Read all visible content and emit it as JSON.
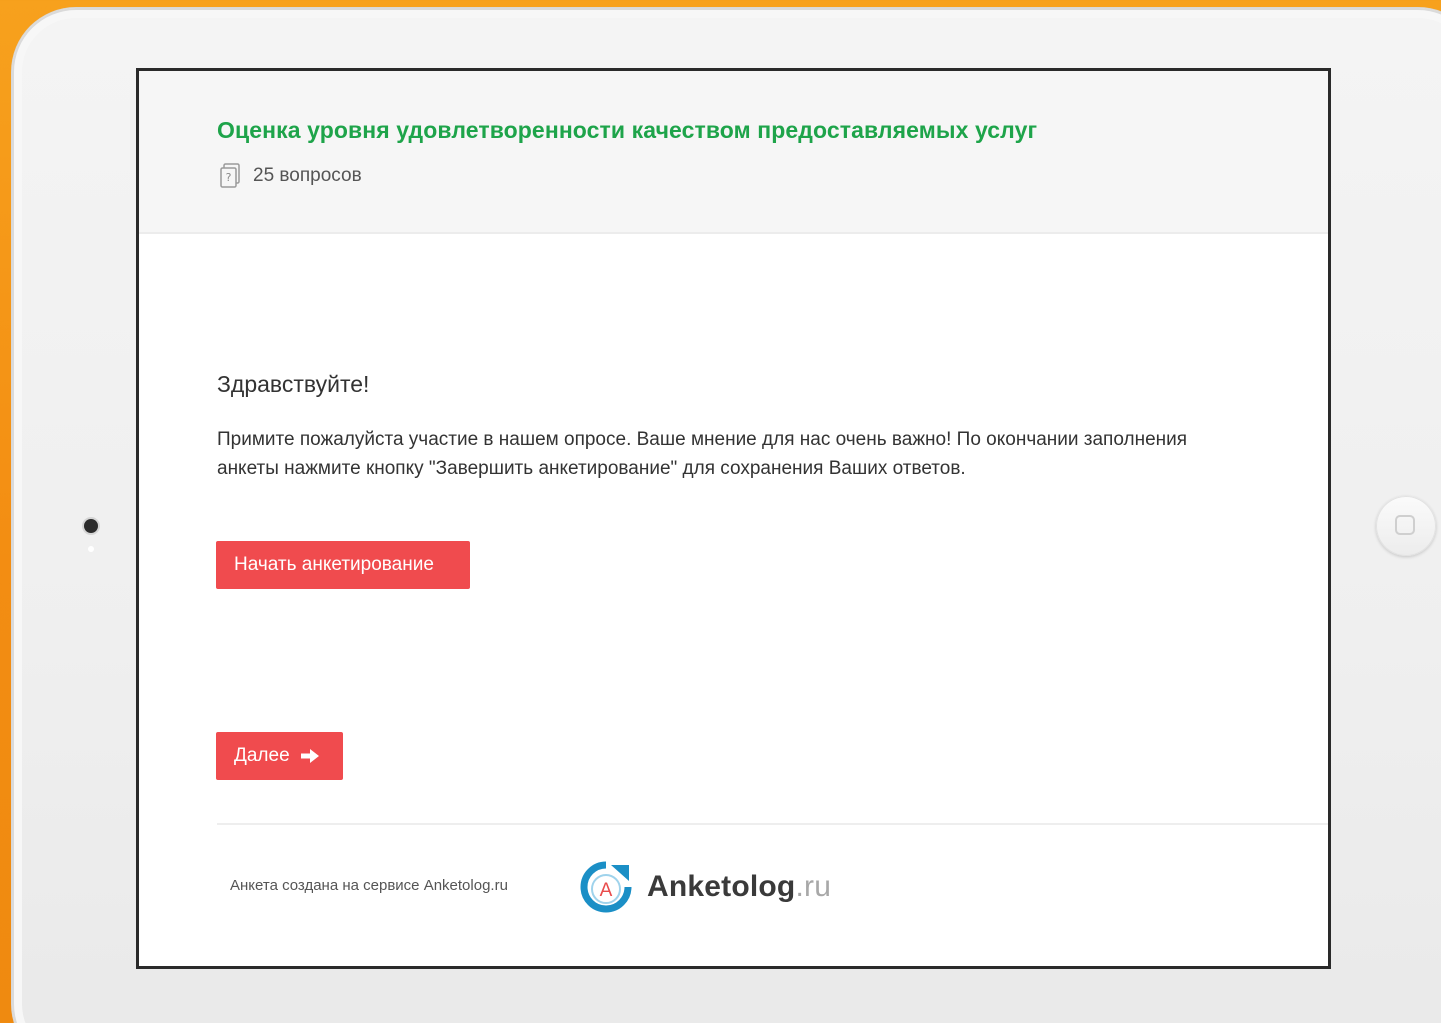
{
  "survey": {
    "title": "Оценка уровня удовлетворенности качеством предоставляемых услуг",
    "question_count": "25 вопросов"
  },
  "intro": {
    "greeting": "Здравствуйте!",
    "text": "Примите пожалуйста участие в нашем опросе. Ваше мнение для нас очень важно! По окончании заполнения анкеты нажмите кнопку \"Завершить анкетирование\" для сохранения Ваших ответов."
  },
  "actions": {
    "start_label": "Начать анкетирование",
    "next_label": "Далее"
  },
  "footer": {
    "created_text": "Анкета создана на сервисе Anketolog.ru",
    "brand_name": "Anketolog",
    "brand_tld": ".ru",
    "logo_letter": "A"
  },
  "icons": {
    "question_count": "document-question-icon",
    "next": "arrow-right-icon",
    "brand": "anketolog-logo-icon"
  },
  "colors": {
    "title_green": "#1ea44a",
    "button_red": "#f04b4e",
    "logo_blue": "#1b8fc6",
    "logo_red": "#e94b4b"
  }
}
